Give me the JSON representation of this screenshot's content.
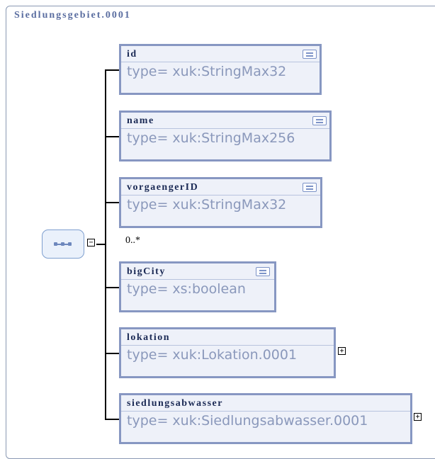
{
  "container": {
    "title": "Siedlungsgebiet.0001"
  },
  "sequence": {
    "occurrence": "0..*"
  },
  "elements": [
    {
      "name": "id",
      "type": "type= xuk:StringMax32",
      "has_doc": true,
      "expandable": false
    },
    {
      "name": "name",
      "type": "type= xuk:StringMax256",
      "has_doc": true,
      "expandable": false
    },
    {
      "name": "vorgaengerID",
      "type": "type= xuk:StringMax32",
      "has_doc": true,
      "expandable": false
    },
    {
      "name": "bigCity",
      "type": "type= xs:boolean",
      "has_doc": true,
      "expandable": false
    },
    {
      "name": "lokation",
      "type": "type= xuk:Lokation.0001",
      "has_doc": false,
      "expandable": true
    },
    {
      "name": "siedlungsabwasser",
      "type": "type= xuk:Siedlungsabwasser.0001",
      "has_doc": false,
      "expandable": true
    }
  ],
  "icons": {
    "documentation": "documentation-icon",
    "sequence": "sequence-compositor-icon",
    "collapse": "minus-box-icon",
    "expand": "plus-box-icon"
  },
  "colors": {
    "element_border": "#8797c2",
    "element_fill": "#eef1f9",
    "title_text": "#5a6da0",
    "type_text": "#8a98bb"
  }
}
